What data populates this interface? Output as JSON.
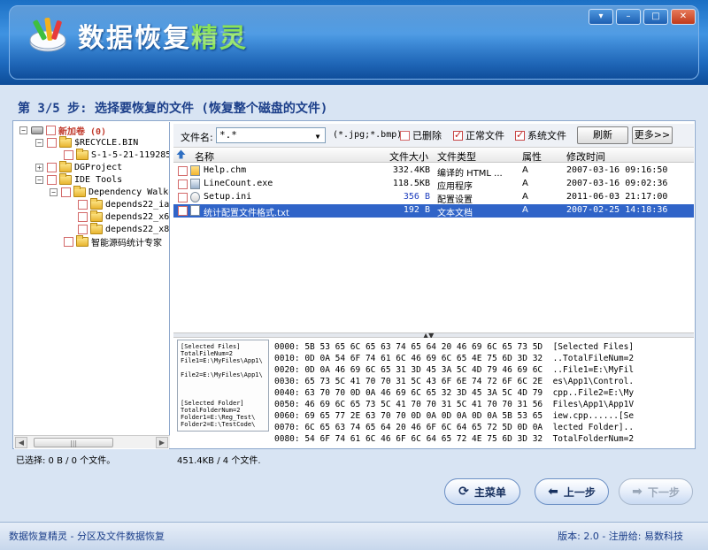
{
  "window": {
    "title_plain": "数据恢复",
    "title_highlight": "精灵",
    "controls": [
      "▾",
      "–",
      "□",
      "✕"
    ]
  },
  "step": {
    "title": "第 3/5 步: 选择要恢复的文件 (恢复整个磁盘的文件)"
  },
  "tree": {
    "items": [
      {
        "label": "新加卷 (0)",
        "depth": 0,
        "type": "drive",
        "expander": "−"
      },
      {
        "label": "$RECYCLE.BIN",
        "depth": 1,
        "type": "folder",
        "expander": "−"
      },
      {
        "label": "S-1-5-21-1192850",
        "depth": 2,
        "type": "folder",
        "expander": ""
      },
      {
        "label": "DGProject",
        "depth": 1,
        "type": "folder",
        "expander": "+"
      },
      {
        "label": "IDE Tools",
        "depth": 1,
        "type": "folder",
        "expander": "−"
      },
      {
        "label": "Dependency Walke",
        "depth": 2,
        "type": "folder",
        "expander": "−"
      },
      {
        "label": "depends22_ia6",
        "depth": 3,
        "type": "folder",
        "expander": ""
      },
      {
        "label": "depends22_x64",
        "depth": 3,
        "type": "folder",
        "expander": ""
      },
      {
        "label": "depends22_x86",
        "depth": 3,
        "type": "folder",
        "expander": ""
      },
      {
        "label": "智能源码统计专家",
        "depth": 2,
        "type": "folder",
        "expander": ""
      }
    ],
    "hscroll_dots": "|||"
  },
  "filter": {
    "label": "文件名:",
    "value": "*.*",
    "hint": "(*.jpg;*.bmp)",
    "deleted_label": "已删除",
    "normal_label": "正常文件",
    "system_label": "系统文件",
    "refresh_label": "刷新",
    "more_label": "更多>>"
  },
  "list": {
    "headers": {
      "name": "名称",
      "size": "文件大小",
      "type": "文件类型",
      "attr": "属性",
      "mtime": "修改时间"
    },
    "rows": [
      {
        "name": "Help.chm",
        "size": "332.4KB",
        "type": "编译的 HTML ...",
        "attr": "A",
        "mtime": "2007-03-16 09:16:50",
        "icon": "chm"
      },
      {
        "name": "LineCount.exe",
        "size": "118.5KB",
        "type": "应用程序",
        "attr": "A",
        "mtime": "2007-03-16 09:02:36",
        "icon": "exe"
      },
      {
        "name": "Setup.ini",
        "size": "356 B",
        "type": "配置设置",
        "attr": "A",
        "mtime": "2011-06-03 21:17:00",
        "icon": "ini"
      },
      {
        "name": "统计配置文件格式.txt",
        "size": "192 B",
        "type": "文本文档",
        "attr": "A",
        "mtime": "2007-02-25 14:18:36",
        "icon": "txt"
      }
    ]
  },
  "preview": {
    "text_lines": [
      "[Selected Files]",
      "TotalFileNum=2",
      "File1=E:\\MyFiles\\App1\\",
      "",
      "File2=E:\\MyFiles\\App1\\",
      "",
      "",
      "",
      "[Selected Folder]",
      "TotalFolderNum=2",
      "Folder1=E:\\Reg_Test\\",
      "Folder2=E:\\TestCode\\"
    ],
    "hex_lines": [
      "0000: 5B 53 65 6C 65 63 74 65 64 20 46 69 6C 65 73 5D  [Selected Files]",
      "0010: 0D 0A 54 6F 74 61 6C 46 69 6C 65 4E 75 6D 3D 32  ..TotalFileNum=2",
      "0020: 0D 0A 46 69 6C 65 31 3D 45 3A 5C 4D 79 46 69 6C  ..File1=E:\\MyFil",
      "0030: 65 73 5C 41 70 70 31 5C 43 6F 6E 74 72 6F 6C 2E  es\\App1\\Control.",
      "0040: 63 70 70 0D 0A 46 69 6C 65 32 3D 45 3A 5C 4D 79  cpp..File2=E:\\My",
      "0050: 46 69 6C 65 73 5C 41 70 70 31 5C 41 70 70 31 56  Files\\App1\\App1V",
      "0060: 69 65 77 2E 63 70 70 0D 0A 0D 0A 0D 0A 5B 53 65  iew.cpp......[Se",
      "0070: 6C 65 63 74 65 64 20 46 6F 6C 64 65 72 5D 0D 0A  lected Folder]..",
      "0080: 54 6F 74 61 6C 46 6F 6C 64 65 72 4E 75 6D 3D 32  TotalFolderNum=2"
    ]
  },
  "status": {
    "selected": "已选择: 0 B / 0 个文件。",
    "total": "451.4KB / 4 个文件."
  },
  "nav": {
    "main_menu": "主菜单",
    "prev": "上一步",
    "next": "下一步"
  },
  "footer": {
    "left": "数据恢复精灵 - 分区及文件数据恢复",
    "right": "版本: 2.0 - 注册给: 易数科技"
  }
}
